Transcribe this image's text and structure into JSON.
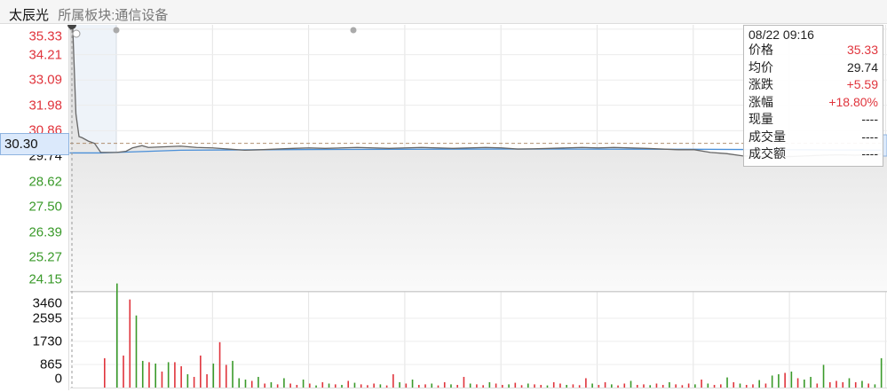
{
  "header": {
    "stock_name": "太辰光",
    "sector": "所属板块:通信设备"
  },
  "price_axis": {
    "labels": [
      {
        "v": "35.33",
        "c": "red",
        "p": 35.33
      },
      {
        "v": "34.21",
        "c": "red",
        "p": 34.21
      },
      {
        "v": "33.09",
        "c": "red",
        "p": 33.09
      },
      {
        "v": "31.98",
        "c": "red",
        "p": 31.98
      },
      {
        "v": "30.86",
        "c": "red",
        "p": 30.86
      },
      {
        "v": "29.74",
        "c": "blk2",
        "p": 29.74
      },
      {
        "v": "28.62",
        "c": "grn",
        "p": 28.62
      },
      {
        "v": "27.50",
        "c": "grn",
        "p": 27.5
      },
      {
        "v": "26.39",
        "c": "grn",
        "p": 26.39
      },
      {
        "v": "25.27",
        "c": "grn",
        "p": 25.27
      },
      {
        "v": "24.15",
        "c": "grn",
        "p": 24.15
      }
    ],
    "current": "30.30"
  },
  "volume_axis": {
    "labels": [
      {
        "v": "3460",
        "q": 3460
      },
      {
        "v": "2595",
        "q": 2595
      },
      {
        "v": "1730",
        "q": 1730
      },
      {
        "v": "865",
        "q": 865
      },
      {
        "v": "0",
        "q": 0
      }
    ]
  },
  "tooltip": {
    "time": "08/22 09:16",
    "rows": [
      {
        "k": "价格",
        "v": "35.33",
        "c": "#e0343c"
      },
      {
        "k": "均价",
        "v": "29.74",
        "c": "#222"
      },
      {
        "k": "涨跌",
        "v": "+5.59",
        "c": "#e0343c"
      },
      {
        "k": "涨幅",
        "v": "+18.80%",
        "c": "#e0343c"
      },
      {
        "k": "现量",
        "v": "----",
        "c": "#222"
      },
      {
        "k": "成交量",
        "v": "----",
        "c": "#222"
      },
      {
        "k": "成交额",
        "v": "----",
        "c": "#222"
      }
    ]
  },
  "colors": {
    "up": "#e0343c",
    "down": "#3a9a2a",
    "price_line": "#666666",
    "avg_line": "#4a8fd8"
  },
  "chart_data": {
    "type": "line",
    "prev_close": 29.74,
    "ylim": [
      24.15,
      35.33
    ],
    "reference_price": 30.3,
    "price": [
      [
        -15,
        35.33
      ],
      [
        -14,
        35.33
      ],
      [
        -13,
        31.6
      ],
      [
        -12,
        30.6
      ],
      [
        -11,
        30.55
      ],
      [
        -9,
        30.4
      ],
      [
        -7,
        30.3
      ],
      [
        -5,
        29.9
      ],
      [
        0,
        29.9
      ],
      [
        3,
        29.95
      ],
      [
        5,
        30.1
      ],
      [
        8,
        30.2
      ],
      [
        10,
        30.12
      ],
      [
        15,
        30.15
      ],
      [
        20,
        30.18
      ],
      [
        25,
        30.12
      ],
      [
        30,
        30.1
      ],
      [
        35,
        30.05
      ],
      [
        40,
        30.0
      ],
      [
        45,
        30.02
      ],
      [
        50,
        30.05
      ],
      [
        55,
        30.08
      ],
      [
        60,
        30.1
      ],
      [
        65,
        30.08
      ],
      [
        70,
        30.1
      ],
      [
        75,
        30.12
      ],
      [
        80,
        30.1
      ],
      [
        85,
        30.08
      ],
      [
        90,
        30.1
      ],
      [
        95,
        30.12
      ],
      [
        100,
        30.1
      ],
      [
        105,
        30.08
      ],
      [
        110,
        30.1
      ],
      [
        115,
        30.12
      ],
      [
        120,
        30.1
      ],
      [
        125,
        30.05
      ],
      [
        130,
        30.06
      ],
      [
        135,
        30.08
      ],
      [
        140,
        30.1
      ],
      [
        145,
        30.12
      ],
      [
        150,
        30.1
      ],
      [
        155,
        30.12
      ],
      [
        160,
        30.1
      ],
      [
        165,
        30.08
      ],
      [
        170,
        30.05
      ],
      [
        175,
        30.02
      ],
      [
        180,
        30.02
      ],
      [
        185,
        29.9
      ],
      [
        190,
        29.85
      ],
      [
        195,
        29.75
      ],
      [
        200,
        29.72
      ],
      [
        205,
        29.7
      ],
      [
        210,
        29.72
      ],
      [
        215,
        29.75
      ],
      [
        220,
        29.78
      ],
      [
        225,
        29.8
      ],
      [
        230,
        29.78
      ],
      [
        235,
        29.8
      ],
      [
        240,
        29.85
      ]
    ],
    "avg": [
      [
        -15,
        29.88
      ],
      [
        -5,
        29.88
      ],
      [
        0,
        29.9
      ],
      [
        20,
        30.0
      ],
      [
        60,
        30.03
      ],
      [
        120,
        30.05
      ],
      [
        180,
        30.04
      ],
      [
        240,
        30.0
      ]
    ],
    "volume": [
      [
        -4,
        1100
      ],
      [
        0,
        -3900
      ],
      [
        1,
        1200
      ],
      [
        2,
        3300
      ],
      [
        3,
        -2700
      ],
      [
        4,
        -1000
      ],
      [
        5,
        950
      ],
      [
        6,
        -900
      ],
      [
        7,
        600
      ],
      [
        8,
        -950
      ],
      [
        9,
        950
      ],
      [
        10,
        800
      ],
      [
        11,
        -500
      ],
      [
        12,
        400
      ],
      [
        13,
        1200
      ],
      [
        14,
        500
      ],
      [
        15,
        -900
      ],
      [
        16,
        1700
      ],
      [
        17,
        850
      ],
      [
        18,
        -1000
      ],
      [
        19,
        -350
      ],
      [
        20,
        -300
      ],
      [
        21,
        250
      ],
      [
        22,
        -400
      ],
      [
        23,
        150
      ],
      [
        24,
        -200
      ],
      [
        25,
        120
      ],
      [
        26,
        -350
      ],
      [
        27,
        150
      ],
      [
        28,
        100
      ],
      [
        29,
        -300
      ],
      [
        30,
        150
      ],
      [
        31,
        -80
      ],
      [
        32,
        200
      ],
      [
        33,
        -150
      ],
      [
        34,
        120
      ],
      [
        35,
        -100
      ],
      [
        36,
        250
      ],
      [
        37,
        -180
      ],
      [
        38,
        120
      ],
      [
        39,
        90
      ],
      [
        40,
        150
      ],
      [
        41,
        -120
      ],
      [
        42,
        80
      ],
      [
        43,
        500
      ],
      [
        44,
        -200
      ],
      [
        45,
        150
      ],
      [
        46,
        -300
      ],
      [
        47,
        100
      ],
      [
        48,
        120
      ],
      [
        49,
        -150
      ],
      [
        50,
        80
      ],
      [
        51,
        200
      ],
      [
        52,
        -120
      ],
      [
        53,
        100
      ],
      [
        54,
        400
      ],
      [
        55,
        -150
      ],
      [
        56,
        120
      ],
      [
        57,
        90
      ],
      [
        58,
        -200
      ],
      [
        59,
        150
      ],
      [
        60,
        100
      ],
      [
        61,
        -120
      ],
      [
        62,
        180
      ],
      [
        63,
        90
      ],
      [
        64,
        -150
      ],
      [
        65,
        120
      ],
      [
        66,
        100
      ],
      [
        67,
        -80
      ],
      [
        68,
        200
      ],
      [
        69,
        150
      ],
      [
        70,
        -100
      ],
      [
        71,
        120
      ],
      [
        72,
        90
      ],
      [
        73,
        350
      ],
      [
        74,
        -150
      ],
      [
        75,
        100
      ],
      [
        76,
        200
      ],
      [
        77,
        -120
      ],
      [
        78,
        80
      ],
      [
        79,
        150
      ],
      [
        80,
        -250
      ],
      [
        81,
        100
      ],
      [
        82,
        120
      ],
      [
        83,
        -90
      ],
      [
        84,
        150
      ],
      [
        85,
        100
      ],
      [
        86,
        -200
      ],
      [
        87,
        120
      ],
      [
        88,
        90
      ],
      [
        89,
        150
      ],
      [
        90,
        -120
      ],
      [
        91,
        300
      ],
      [
        92,
        -150
      ],
      [
        93,
        100
      ],
      [
        94,
        120
      ],
      [
        95,
        -380
      ],
      [
        96,
        200
      ],
      [
        97,
        -150
      ],
      [
        98,
        100
      ],
      [
        99,
        120
      ],
      [
        100,
        -280
      ],
      [
        101,
        150
      ],
      [
        102,
        -450
      ],
      [
        103,
        -500
      ],
      [
        104,
        550
      ],
      [
        105,
        -600
      ],
      [
        106,
        350
      ],
      [
        107,
        -300
      ],
      [
        108,
        -400
      ],
      [
        109,
        150
      ],
      [
        110,
        -850
      ],
      [
        111,
        200
      ],
      [
        112,
        250
      ],
      [
        113,
        200
      ],
      [
        114,
        -350
      ],
      [
        115,
        200
      ],
      [
        116,
        -250
      ],
      [
        117,
        150
      ],
      [
        118,
        -120
      ],
      [
        119,
        -1100
      ]
    ]
  }
}
